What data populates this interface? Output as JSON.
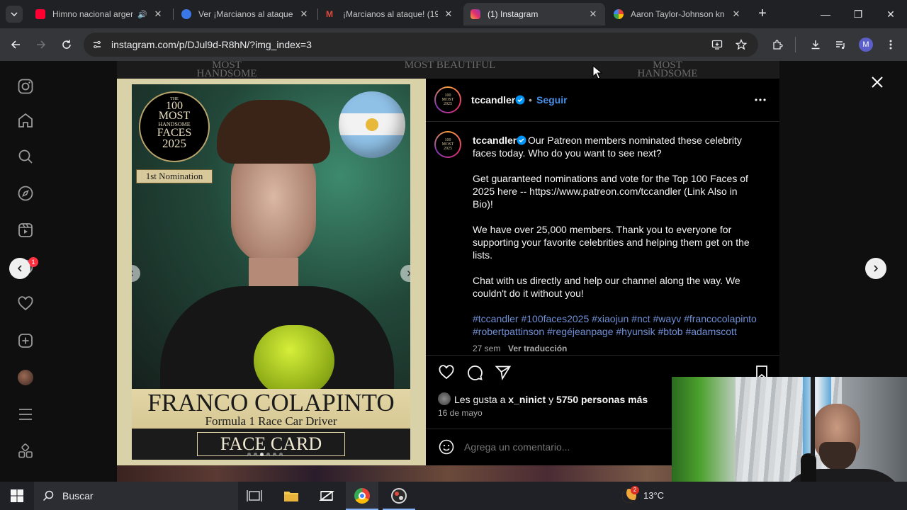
{
  "browser": {
    "tabs": [
      {
        "title": "Himno nacional argentino",
        "favicon_color": "#ff0033",
        "active": false
      },
      {
        "title": "Ver ¡Marcianos al ataque!",
        "favicon_color": "#3b78e7",
        "active": false
      },
      {
        "title": "¡Marcianos al ataque! (19",
        "favicon_color": "#b3261e",
        "active": false
      },
      {
        "title": "(1) Instagram",
        "favicon_color": "#e1306c",
        "active": true
      },
      {
        "title": "Aaron Taylor-Johnson kn",
        "favicon_color": "#4285f4",
        "active": false
      }
    ],
    "new_tab_label": "+",
    "url": "instagram.com/p/DJul9d-R8hN/?img_index=3",
    "profile_initial": "M"
  },
  "instagram": {
    "nav_badge": "1",
    "background_words": [
      "MOST HANDSOME",
      "MOST BEAUTIFUL",
      "MOST HANDSOME"
    ],
    "post": {
      "image": {
        "badge_the": "THE",
        "badge_number": "100",
        "badge_line1": "MOST",
        "badge_line2": "HANDSOME",
        "badge_line3": "FACES",
        "badge_year": "2025",
        "nomination": "1st Nomination",
        "name": "FRANCO COLAPINTO",
        "role": "Formula 1 Race Car Driver",
        "card_label": "FACE CARD"
      },
      "username": "tccandler",
      "follow_label": "Seguir",
      "caption_lines": [
        "Our Patreon members nominated these celebrity",
        "faces today. Who do you want to see next?"
      ],
      "paragraph2": [
        "Get guaranteed nominations and vote for the Top 100 Faces of",
        "2025 here -- https://www.patreon.com/tccandler (Link Also in",
        "Bio)!"
      ],
      "paragraph3": [
        "We have over 25,000 members. Thank you to everyone for",
        "supporting your favorite celebrities and helping them get on the",
        "lists."
      ],
      "paragraph4": [
        "Chat with us directly and help our channel along the way. We",
        "couldn't do it without you!"
      ],
      "hashtags_line1": "#tccandler #100faces2025 #xiaojun #nct #wayv #francocolapinto",
      "hashtags_line2": "#robertpattinson #regéjeanpage #hyunsik #btob #adamscott",
      "time_ago": "27 sem",
      "translate_label": "Ver traducción",
      "likes_prefix": "Les gusta a ",
      "likes_user": "x_ninict",
      "likes_mid": " y ",
      "likes_count": "5750 personas más",
      "date": "16 de mayo",
      "comment_placeholder": "Agrega un comentario..."
    }
  },
  "taskbar": {
    "search_label": "Buscar",
    "weather_badge": "2",
    "temperature": "13°C"
  }
}
